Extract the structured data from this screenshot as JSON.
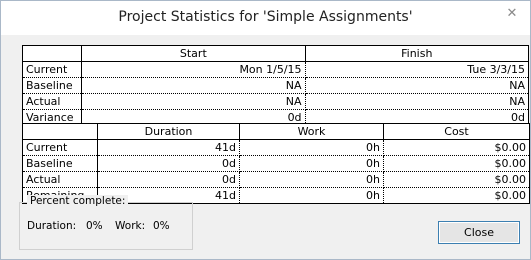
{
  "window": {
    "title": "Project Statistics for 'Simple Assignments'"
  },
  "dates_table": {
    "headers": [
      "",
      "Start",
      "Finish"
    ],
    "rows": [
      {
        "label": "Current",
        "start": "Mon 1/5/15",
        "finish": "Tue 3/3/15"
      },
      {
        "label": "Baseline",
        "start": "NA",
        "finish": "NA"
      },
      {
        "label": "Actual",
        "start": "NA",
        "finish": "NA"
      },
      {
        "label": "Variance",
        "start": "0d",
        "finish": "0d"
      }
    ]
  },
  "work_table": {
    "headers": [
      "",
      "Duration",
      "Work",
      "Cost"
    ],
    "rows": [
      {
        "label": "Current",
        "duration": "41d",
        "work": "0h",
        "cost": "$0.00"
      },
      {
        "label": "Baseline",
        "duration": "0d",
        "work": "0h",
        "cost": "$0.00"
      },
      {
        "label": "Actual",
        "duration": "0d",
        "work": "0h",
        "cost": "$0.00"
      },
      {
        "label": "Remaining",
        "duration": "41d",
        "work": "0h",
        "cost": "$0.00"
      }
    ]
  },
  "percent_complete": {
    "legend": "Percent complete:",
    "duration_label": "Duration:",
    "duration_value": "0%",
    "work_label": "Work:",
    "work_value": "0%"
  },
  "buttons": {
    "close_label": "Close"
  },
  "icons": {
    "window_close": "close-icon"
  }
}
